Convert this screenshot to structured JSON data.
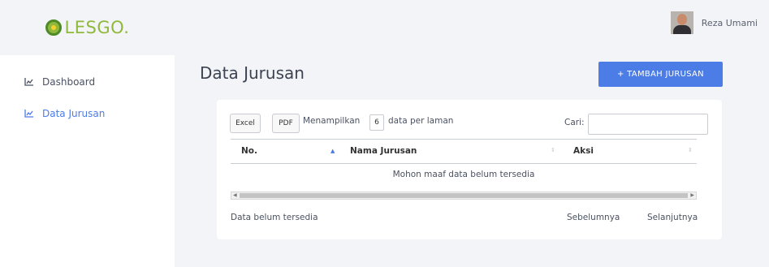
{
  "brand": {
    "name": "LESGO.",
    "color": "#8fb83c"
  },
  "header": {
    "user_name": "Reza Umami"
  },
  "sidebar": {
    "items": [
      {
        "label": "Dashboard",
        "icon": "line-chart-icon",
        "active": false
      },
      {
        "label": "Data Jurusan",
        "icon": "line-chart-icon",
        "active": true
      }
    ],
    "active_color": "#4c7ce6"
  },
  "main": {
    "title": "Data Jurusan",
    "add_button": "+ TAMBAH JURUSAN",
    "accent": "#4c7ce6"
  },
  "table": {
    "export_buttons": [
      "Excel",
      "PDF"
    ],
    "length_prefix": "Menampilkan",
    "length_value": "6",
    "length_suffix": "data per laman",
    "search_label": "Cari:",
    "search_value": "",
    "columns": [
      "No.",
      "Nama Jurusan",
      "Aksi"
    ],
    "empty_message": "Mohon maaf data belum tersedia",
    "info": "Data belum tersedia",
    "pagination": {
      "previous": "Sebelumnya",
      "next": "Selanjutnya"
    }
  }
}
